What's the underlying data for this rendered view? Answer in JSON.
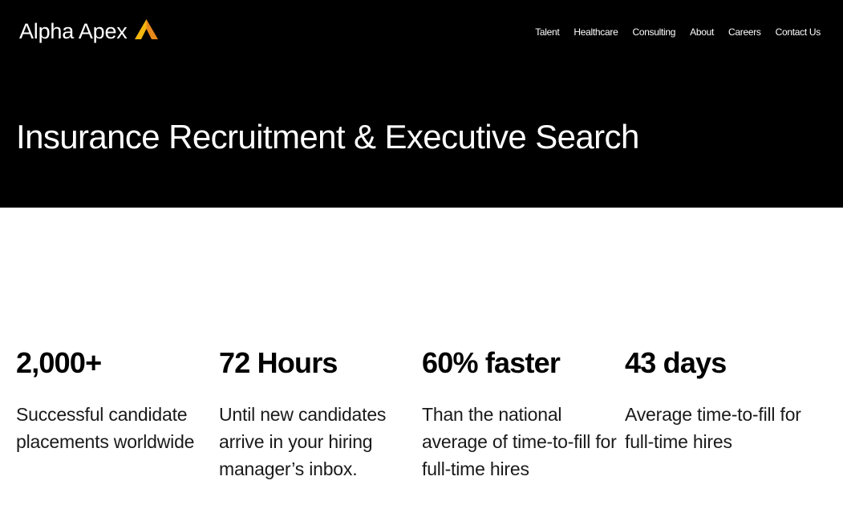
{
  "header": {
    "logo_text": "Alpha Apex",
    "logo_icon": "apex-triangle-icon",
    "nav": [
      {
        "label": "Talent"
      },
      {
        "label": "Healthcare"
      },
      {
        "label": "Consulting"
      },
      {
        "label": "About"
      },
      {
        "label": "Careers"
      },
      {
        "label": "Contact Us"
      }
    ]
  },
  "hero": {
    "title": "Insurance Recruitment & Executive Search"
  },
  "stats": [
    {
      "value": "2,000+",
      "description": "Successful candidate placements worldwide"
    },
    {
      "value": "72 Hours",
      "description": "Until new candidates arrive in your hiring manager’s inbox."
    },
    {
      "value": "60% faster",
      "description": "Than the national average of time-to-fill for full-time hires"
    },
    {
      "value": "43 days",
      "description": "Average time-to-fill for full-time hires"
    }
  ],
  "colors": {
    "hero_background": "#000000",
    "logo_accent_yellow": "#F5B60D",
    "logo_accent_orange": "#E8891B",
    "text_light": "#ffffff",
    "text_dark": "#000000"
  }
}
